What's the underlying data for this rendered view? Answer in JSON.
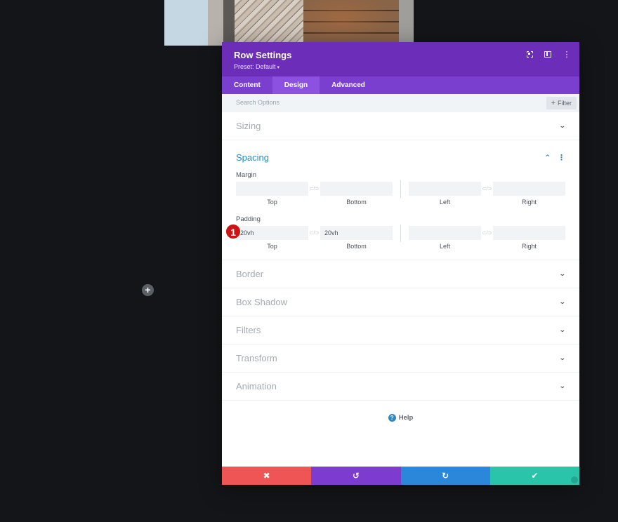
{
  "modal": {
    "title": "Row Settings",
    "preset": "Preset: Default",
    "preset_caret": "▾",
    "header_icons": [
      "expand-icon",
      "split-view-icon",
      "more-options-icon"
    ],
    "kebab": "⋮"
  },
  "tabs": [
    {
      "label": "Content",
      "active": false
    },
    {
      "label": "Design",
      "active": true
    },
    {
      "label": "Advanced",
      "active": false
    }
  ],
  "search": {
    "placeholder": "Search Options",
    "filter_label": "Filter",
    "filter_plus": "+"
  },
  "sections": {
    "sizing": "Sizing",
    "spacing": "Spacing",
    "border": "Border",
    "box_shadow": "Box Shadow",
    "filters": "Filters",
    "transform": "Transform",
    "animation": "Animation",
    "chevron_down": "⌄",
    "chevron_up": "⌃"
  },
  "spacing": {
    "margin": {
      "label": "Margin",
      "top": "",
      "bottom": "",
      "left": "",
      "right": "",
      "sub_labels": [
        "Top",
        "Bottom",
        "Left",
        "Right"
      ]
    },
    "padding": {
      "label": "Padding",
      "top": "20vh",
      "bottom": "20vh",
      "left": "",
      "right": "",
      "sub_labels": [
        "Top",
        "Bottom",
        "Left",
        "Right"
      ]
    },
    "link_icon": "⊂/⊃"
  },
  "annotation": {
    "step_number": "1",
    "color": "#cc1414"
  },
  "help": {
    "label": "Help",
    "icon": "?"
  },
  "footer": {
    "cancel_icon": "✖",
    "undo_icon": "↺",
    "redo_icon": "↻",
    "save_icon": "✔",
    "colors": {
      "cancel": "#ef5555",
      "undo": "#7e3bd0",
      "redo": "#2b87da",
      "save": "#29c4a9"
    }
  },
  "canvas": {
    "add_row_icon": "+"
  },
  "colors": {
    "header": "#6c2eb9",
    "tabs": "#7b3fd0",
    "active_tab": "#8c51e1",
    "accent_blue": "#2b87c5"
  }
}
